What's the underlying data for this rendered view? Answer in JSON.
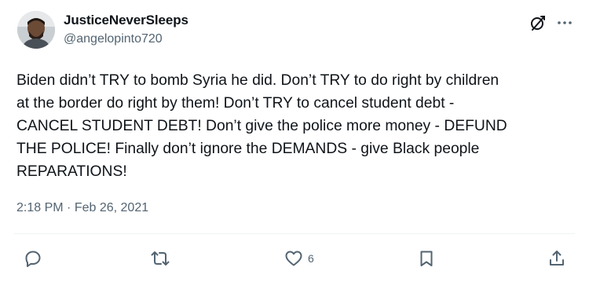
{
  "author": {
    "display_name": "JusticeNeverSleeps",
    "handle": "@angelopinto720"
  },
  "tweet": {
    "text": "Biden didn’t TRY to bomb Syria he did. Don’t TRY to do right by children\nat the border do right by them! Don’t TRY to cancel student debt -\nCANCEL STUDENT DEBT! Don’t give the police more money - DEFUND\nTHE POLICE! Finally don’t ignore the DEMANDS - give Black people\nREPARATIONS!",
    "time": "2:18 PM",
    "separator": "·",
    "date": "Feb 26, 2021"
  },
  "actions": {
    "reply_icon": "reply-icon",
    "retweet_icon": "retweet-icon",
    "like_icon": "heart-icon",
    "like_count": "6",
    "bookmark_icon": "bookmark-icon",
    "share_icon": "share-icon"
  },
  "header_icons": {
    "grok": "grok-icon",
    "more": "more-icon"
  },
  "colors": {
    "text": "#0f1419",
    "secondary": "#536471",
    "divider": "#eff3f4"
  }
}
